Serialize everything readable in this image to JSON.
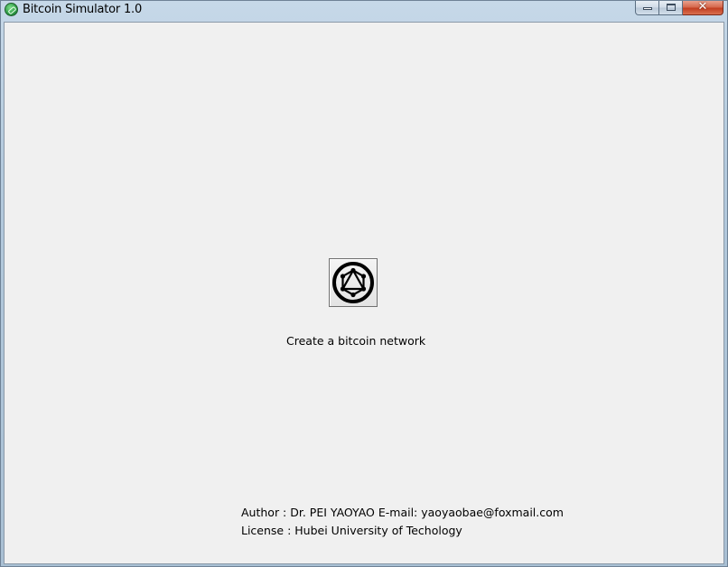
{
  "window": {
    "title": "Bitcoin Simulator 1.0",
    "app_icon": "bitcoin-leaf-icon",
    "buttons": {
      "minimize_icon": "minimize-icon",
      "maximize_icon": "maximize-icon",
      "close_label": "✕"
    }
  },
  "main": {
    "network_button_icon": "network-graph-icon",
    "network_label": "Create a bitcoin network"
  },
  "footer": {
    "author_line": "Author : Dr. PEI YAOYAO E-mail: yaoyaobae@foxmail.com",
    "license_line": "License : Hubei University of Techology"
  },
  "colors": {
    "client_background": "#f0f0f0",
    "close_button": "#c23f22"
  }
}
